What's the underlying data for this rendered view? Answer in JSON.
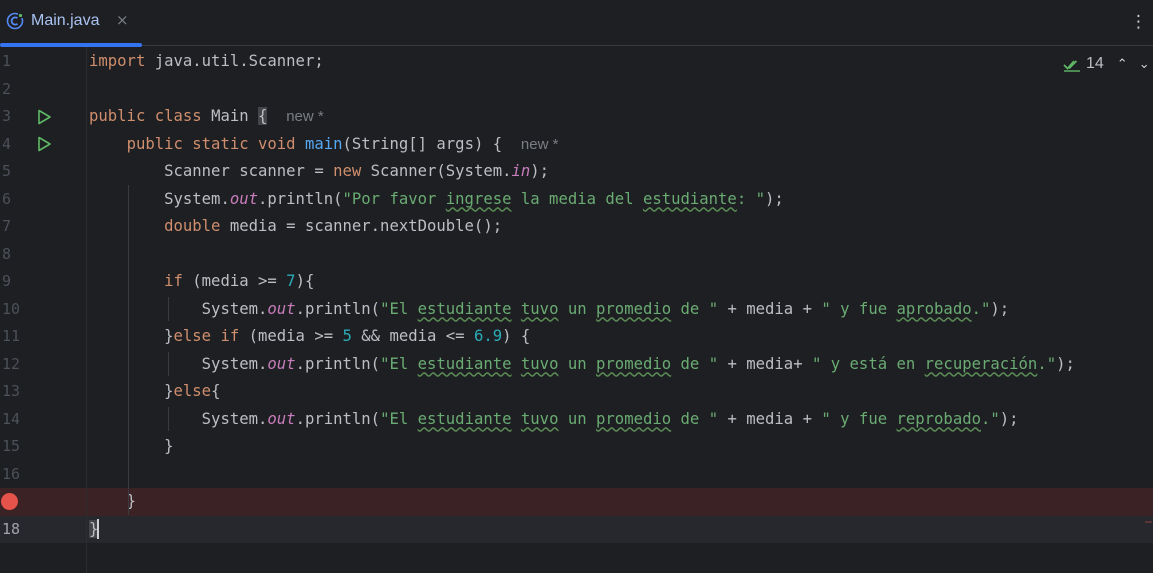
{
  "tab": {
    "label": "Main.java",
    "close": "×"
  },
  "more_menu": "⋮",
  "inspections": {
    "count": "14",
    "up": "⌃",
    "down": "⌄"
  },
  "colors": {
    "accent": "#3574f0",
    "breakpoint": "#e5534b",
    "highlight_line": "#3a2225"
  },
  "gutter": {
    "line_numbers": [
      "1",
      "2",
      "3",
      "4",
      "5",
      "6",
      "7",
      "8",
      "9",
      "10",
      "11",
      "12",
      "13",
      "14",
      "15",
      "16",
      "",
      "18"
    ],
    "run_icons_on_lines": [
      3,
      4
    ],
    "breakpoint_on_line": 17
  },
  "code": {
    "l1_import": "import",
    "l1_rest": " java.util.Scanner;",
    "l3_public": "public",
    "l3_class": " class",
    "l3_name": " Main ",
    "l3_brace": "{",
    "hint_new": "new *",
    "l4_mods": "public static void",
    "l4_main": "main",
    "l4_rest": "(String[] args) { ",
    "l5_a": "Scanner scanner = ",
    "l5_new": "new",
    "l5_b": " Scanner(System.",
    "l5_in": "in",
    "l5_c": ");",
    "sys": "System.",
    "out": "out",
    "println_open": ".println(",
    "l6_s1": "\"Por favor ",
    "l6_w1": "ingrese",
    "l6_s2": " la media del ",
    "l6_w2": "estudiante",
    "l6_s3": ": \"",
    "close_paren": ");",
    "l7_double": "double",
    "l7_rest": " media = scanner.nextDouble();",
    "l9_if": "if",
    "l9_a": " (media >= ",
    "l9_num": "7",
    "l9_b": "){",
    "s_el": "\"El ",
    "w_estudiante": "estudiante",
    "sp": " ",
    "w_tuvo": "tuvo",
    "s_un": " un ",
    "w_promedio": "promedio",
    "s_de": " de \"",
    "plus_media_plus": " + media + ",
    "plus_media_plus_b": " + media+ ",
    "l10_s1": "\" y fue ",
    "l10_w": "aprobado",
    "l10_s2": ".\"",
    "l11_a": "}",
    "l11_else": "else if",
    "l11_b": " (media >= ",
    "l11_n1": "5",
    "l11_c": " && media <= ",
    "l11_n2": "6.9",
    "l11_d": ") {",
    "l12_s1": "\" y está en ",
    "l12_w": "recuperación",
    "l12_s2": ".\"",
    "l13_a": "}",
    "l13_else": "else",
    "l13_b": "{",
    "l14_s1": "\" y fue ",
    "l14_w": "reprobado",
    "l14_s2": ".\"",
    "l15": "}",
    "l17": "}",
    "l18": "}"
  }
}
